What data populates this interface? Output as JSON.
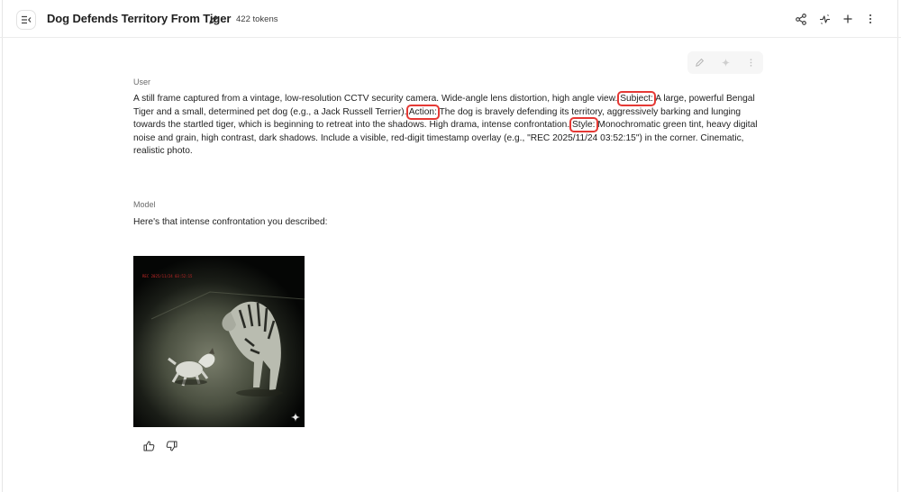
{
  "header": {
    "title": "Dog Defends Territory From Tiger",
    "tokens": "422 tokens"
  },
  "conversation": {
    "user": {
      "role": "User",
      "segments": [
        {
          "text": "A still frame captured from a vintage, low-resolution CCTV security camera. Wide-angle lens distortion, high angle view. ",
          "highlight": false
        },
        {
          "text": "Subject:",
          "highlight": true
        },
        {
          "text": " A large, powerful Bengal Tiger and a small, determined pet dog (e.g., a Jack Russell Terrier). ",
          "highlight": false
        },
        {
          "text": "Action:",
          "highlight": true
        },
        {
          "text": " The dog is bravely defending its territory, aggressively barking and lunging towards the startled tiger, which is beginning to retreat into the shadows. High drama, intense confrontation. ",
          "highlight": false
        },
        {
          "text": "Style:",
          "highlight": true
        },
        {
          "text": " Monochromatic green tint, heavy digital noise and grain, high contrast, dark shadows. Include a visible, red-digit timestamp overlay (e.g., \"REC 2025/11/24 03:52:15\") in the corner. Cinematic, realistic photo.",
          "highlight": false
        }
      ]
    },
    "model": {
      "role": "Model",
      "text": "Here's that intense confrontation you described:",
      "image": {
        "overlay_text": "REC 2025/11/24 03:52:15",
        "accent": "#c62828"
      }
    }
  },
  "icons": [
    "sidebar-toggle-icon",
    "edit-icon",
    "share-icon",
    "compare-icon",
    "plus-icon",
    "more-vert-icon",
    "sparkle-icon",
    "thumbs-up-icon",
    "thumbs-down-icon"
  ],
  "colors": {
    "highlight": "#e53935",
    "muted_text": "#6b6b6b"
  }
}
